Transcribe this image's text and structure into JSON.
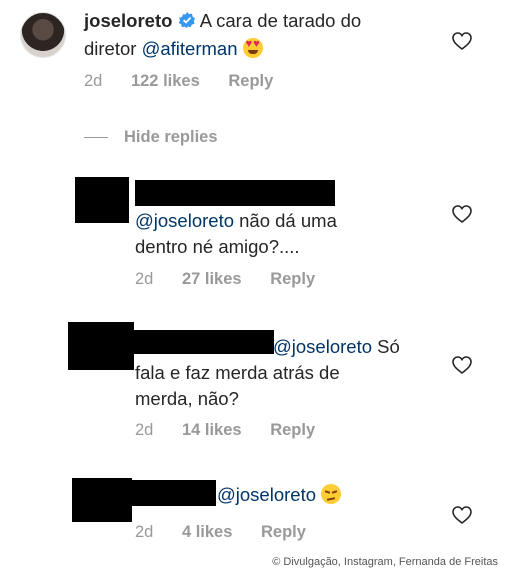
{
  "icons": {
    "heart": "heart-outline-icon",
    "verified": "verified-badge-icon"
  },
  "colors": {
    "text": "#262626",
    "muted": "#999999",
    "mention": "#003569",
    "verified": "#3897f0"
  },
  "main_comment": {
    "username": "joseloreto",
    "text_part1": "A cara de tarado do",
    "text_part2": "diretor",
    "mention": "@afiterman",
    "emoji": "smiling-face-with-heart-eyes",
    "time": "2d",
    "likes": "122 likes",
    "reply": "Reply"
  },
  "hide_replies": "Hide replies",
  "replies": [
    {
      "mention": "@joseloreto",
      "text_line1": " não dá uma",
      "text_line2": "dentro né amigo?....",
      "time": "2d",
      "likes": "27 likes",
      "reply": "Reply"
    },
    {
      "mention": "@joseloreto",
      "text_line1": " Só",
      "text_line2": "fala e faz merda atrás de",
      "text_line3": "merda, não?",
      "time": "2d",
      "likes": "14 likes",
      "reply": "Reply"
    },
    {
      "mention": "@joseloreto",
      "emoji": "pensive-face",
      "time": "2d",
      "likes": "4 likes",
      "reply": "Reply"
    }
  ],
  "credit": "© Divulgação, Instagram, Fernanda de Freitas"
}
